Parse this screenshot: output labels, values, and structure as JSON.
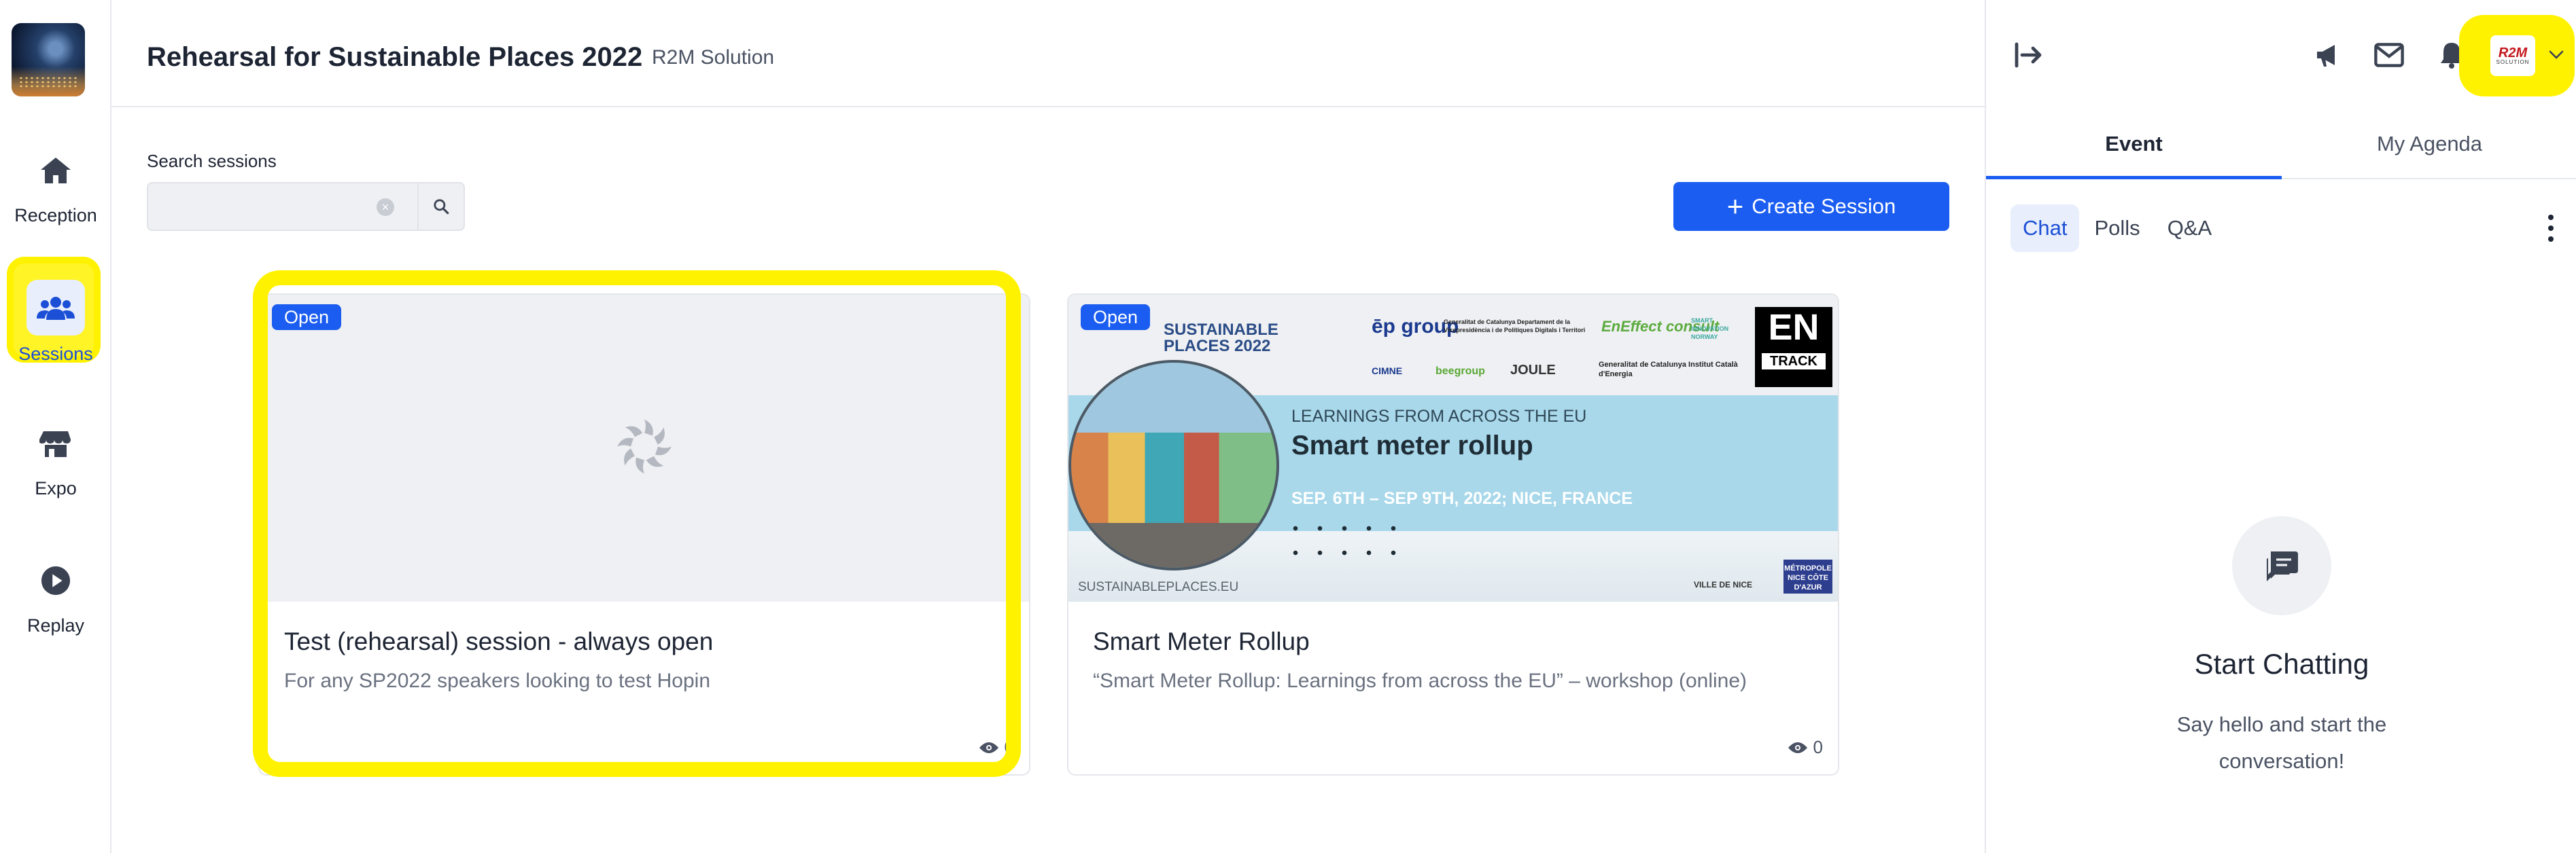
{
  "app": {
    "title": "Rehearsal for Sustainable Places 2022",
    "organizer": "R2M Solution"
  },
  "nav": {
    "items": [
      {
        "label": "Reception",
        "icon": "home-icon",
        "active": false
      },
      {
        "label": "Sessions",
        "icon": "people-icon",
        "active": true
      },
      {
        "label": "Expo",
        "icon": "store-icon",
        "active": false
      },
      {
        "label": "Replay",
        "icon": "play-circle-icon",
        "active": false
      }
    ]
  },
  "search": {
    "label": "Search sessions",
    "placeholder": "",
    "value": ""
  },
  "create_button": {
    "label": "Create Session"
  },
  "sessions": [
    {
      "badge": "Open",
      "title": "Test (rehearsal) session - always open",
      "description": "For any SP2022 speakers looking to test Hopin",
      "views": "0",
      "thumbnail": "loading-spinner"
    },
    {
      "badge": "Open",
      "title": "Smart Meter Rollup",
      "description": "“Smart Meter Rollup: Learnings from across the EU” – workshop (online)",
      "views": "0",
      "banner": {
        "event_line1": "SUSTAINABLE",
        "event_line2": "PLACES 2022",
        "kicker": "LEARNINGS FROM ACROSS THE EU",
        "headline": "Smart meter rollup",
        "dates": "SEP. 6TH – SEP 9TH, 2022; NICE, FRANCE",
        "url": "SUSTAINABLEPLACES.EU",
        "logo_en": "EN",
        "logo_track": "TRACK",
        "logo_ep": "ēp group",
        "logo_gencat1": "Generalitat de Catalunya Departament de la Vicepresidència i de Polítiques Digitals i Territori",
        "logo_eneffect": "EnEffect consult",
        "logo_smart": "SMART INNOVATION NORWAY",
        "logo_cimne": "CIMNE",
        "logo_bee": "beegroup",
        "logo_joule": "JOULE",
        "logo_gencat2": "Generalitat de Catalunya Institut Català d'Energia",
        "logo_nice": "VILLE DE NICE",
        "logo_metropole": "MÉTROPOLE NICE CÔTE D'AZUR"
      }
    }
  ],
  "sidebar": {
    "tabs": [
      {
        "label": "Event",
        "active": true
      },
      {
        "label": "My Agenda",
        "active": false
      }
    ],
    "subtabs": [
      {
        "label": "Chat",
        "active": true
      },
      {
        "label": "Polls",
        "active": false
      },
      {
        "label": "Q&A",
        "active": false
      }
    ],
    "empty_title": "Start Chatting",
    "empty_text": "Say hello and start the conversation!",
    "avatar_text": "R2M",
    "avatar_sub": "SOLUTION"
  },
  "colors": {
    "accent": "#1b5df0",
    "highlight": "#fff200",
    "badge": "#1b5df0"
  }
}
